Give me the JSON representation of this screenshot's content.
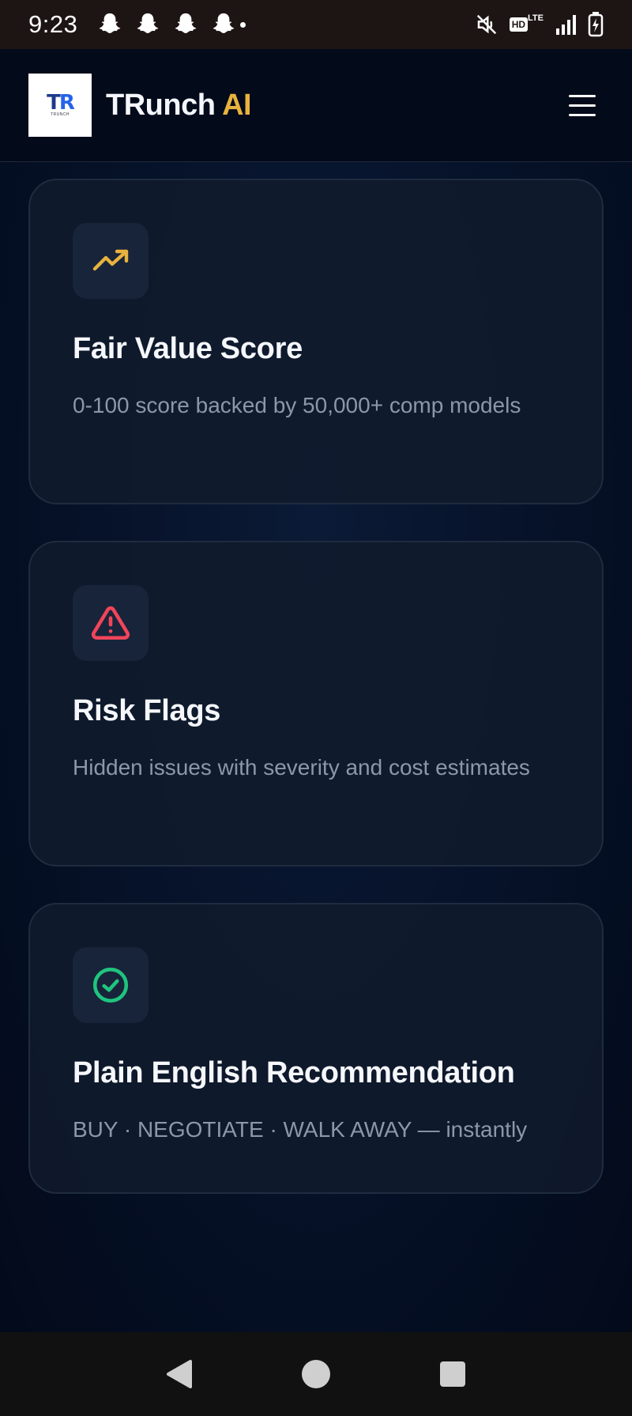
{
  "status_bar": {
    "time": "9:23",
    "notification_icons": [
      "snapchat-icon",
      "snapchat-icon",
      "snapchat-icon",
      "snapchat-icon"
    ],
    "right_icons": [
      "mute-icon",
      "hd-icon",
      "lte-icon",
      "signal-icon",
      "battery-charging-icon"
    ],
    "hd_label": "HD",
    "lte_label": "LTE"
  },
  "header": {
    "logo_text": "TR",
    "logo_subtext": "TRUNCH",
    "brand_name": "TRunch",
    "brand_accent": "AI",
    "menu_icon": "hamburger-menu-icon"
  },
  "features": [
    {
      "icon": "trending-up-icon",
      "icon_color": "#e8b23e",
      "title": "Fair Value Score",
      "description": "0-100 score backed by 50,000+ comp models"
    },
    {
      "icon": "warning-triangle-icon",
      "icon_color": "#f0455a",
      "title": "Risk Flags",
      "description": "Hidden issues with severity and cost estimates"
    },
    {
      "icon": "check-circle-icon",
      "icon_color": "#1fc47e",
      "title": "Plain English Recommendation",
      "description": "BUY · NEGOTIATE · WALK AWAY — instantly"
    }
  ],
  "nav_bar": {
    "buttons": [
      "back-icon",
      "home-icon",
      "recents-icon"
    ]
  },
  "colors": {
    "accent_gold": "#e8b23e",
    "background": "#040b1c",
    "card": "#111b2d"
  }
}
